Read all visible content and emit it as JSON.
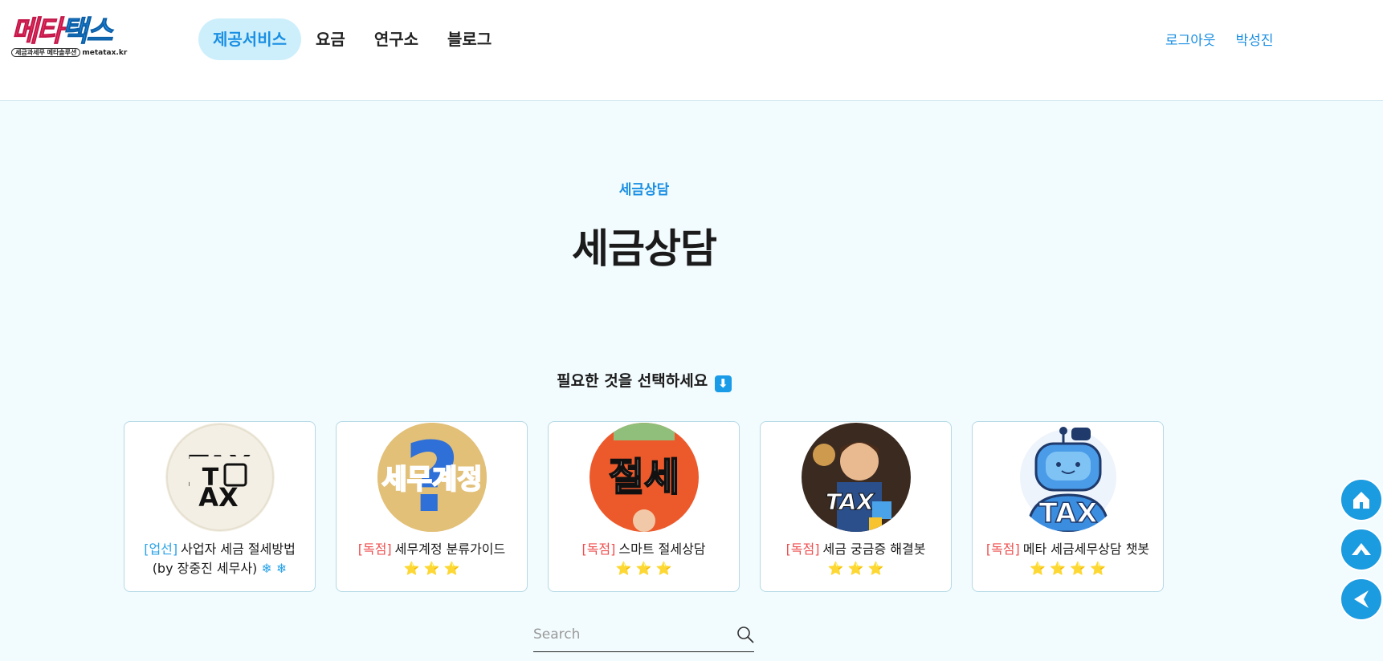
{
  "logo": {
    "title_part1": "메타",
    "title_part2": "택스",
    "subtitle_pill": "세금과세무 메타솔루션",
    "domain": "metatax.kr"
  },
  "nav": {
    "items": [
      "제공서비스",
      "요금",
      "연구소",
      "블로그"
    ],
    "active_index": 0
  },
  "user": {
    "logout": "로그아웃",
    "name": "박성진"
  },
  "main": {
    "eyebrow": "세금상담",
    "title": "세금상담",
    "prompt": "필요한 것을 선택하세요",
    "prompt_icon": "⬇"
  },
  "cards": [
    {
      "tag": "[업선]",
      "tag_color": "#2aa3e8",
      "text": "사업자 세금 절세방법 (by 장중진 세무사)",
      "suffix": "❄ ❄",
      "image": "tax-calculator-icon"
    },
    {
      "tag": "[독점]",
      "tag_color": "#ef4f4f",
      "text": "세무계정 분류가이드",
      "suffix": "⭐ ⭐ ⭐",
      "image": "question-mark-account-icon",
      "image_text": "세무계정"
    },
    {
      "tag": "[독점]",
      "tag_color": "#ef4f4f",
      "text": "스마트 절세상담",
      "suffix": "⭐ ⭐ ⭐",
      "image": "tax-saving-icon",
      "image_text": "절세"
    },
    {
      "tag": "[독점]",
      "tag_color": "#ef4f4f",
      "text": "세금 궁금증 해결봇",
      "suffix": "⭐ ⭐ ⭐",
      "image": "tax-qa-character-icon",
      "image_text": "TAX"
    },
    {
      "tag": "[독점]",
      "tag_color": "#ef4f4f",
      "text": "메타 세금세무상담 챗봇",
      "suffix": "⭐ ⭐ ⭐ ⭐",
      "image": "tax-robot-icon",
      "image_text": "TAX"
    }
  ],
  "search": {
    "placeholder": "Search"
  },
  "colors": {
    "accent": "#1a8fe3",
    "background": "#f2fbfd",
    "fab": "#1b9be0"
  }
}
